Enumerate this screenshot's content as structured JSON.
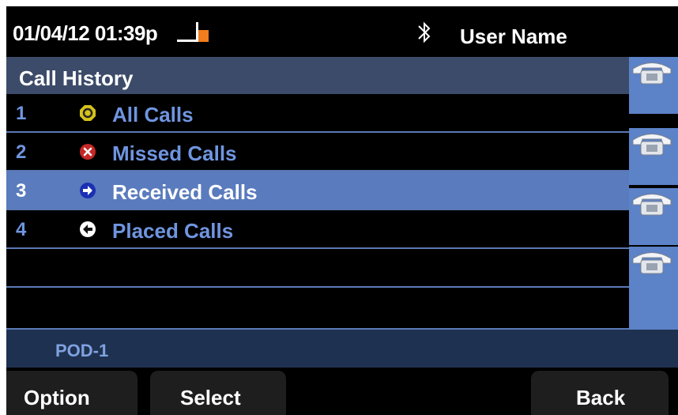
{
  "status_bar": {
    "datetime": "01/04/12 01:39p",
    "handset_icon": "handset-offhook-icon",
    "bluetooth_icon": "bluetooth-icon",
    "user_name": "User Name"
  },
  "call_history": {
    "title": "Call History",
    "items": [
      {
        "number": "1",
        "label": "All Calls",
        "icon": "all-calls-icon",
        "selected": false
      },
      {
        "number": "2",
        "label": "Missed Calls",
        "icon": "missed-calls-icon",
        "selected": false
      },
      {
        "number": "3",
        "label": "Received Calls",
        "icon": "received-calls-icon",
        "selected": true
      },
      {
        "number": "4",
        "label": "Placed Calls",
        "icon": "placed-calls-icon",
        "selected": false
      }
    ]
  },
  "line_keys": [
    {
      "icon": "phone-icon"
    },
    {
      "icon": "phone-icon"
    },
    {
      "icon": "phone-icon"
    },
    {
      "icon": "phone-icon"
    }
  ],
  "pod": {
    "label": "POD-1"
  },
  "softkeys": {
    "option": "Option",
    "select": "Select",
    "back": "Back"
  },
  "colors": {
    "selected_row": "#5a7bbd",
    "list_text": "#6f95e0",
    "title_bar": "#3c4b69",
    "line_key": "#5c82c7",
    "pod_bar": "#1f3150",
    "handset_accent": "#f07d1e",
    "missed_red": "#c62828",
    "all_calls_yellow": "#d6c21a",
    "received_blue": "#1a2fb3"
  }
}
